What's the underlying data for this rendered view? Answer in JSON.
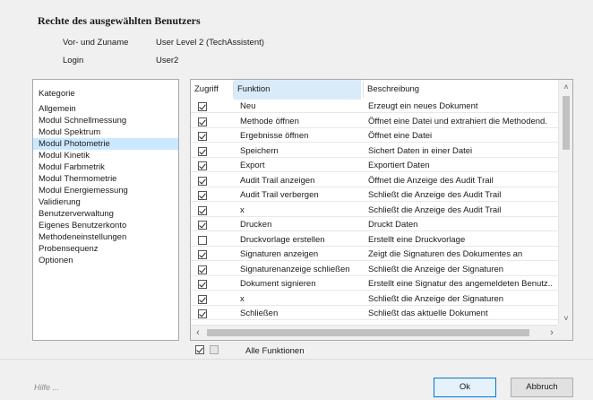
{
  "header": {
    "title": "Rechte des ausgewählten Benutzers",
    "name_label": "Vor- und Zuname",
    "name_value": "User Level 2 (TechAssistent)",
    "login_label": "Login",
    "login_value": "User2"
  },
  "categories": {
    "header": "Kategorie",
    "items": [
      "Allgemein",
      "Modul Schnellmessung",
      "Modul Spektrum",
      "Modul Photometrie",
      "Modul Kinetik",
      "Modul Farbmetrik",
      "Modul Thermometrie",
      "Modul Energiemessung",
      "Validierung",
      "Benutzerverwaltung",
      "Eigenes Benutzerkonto",
      "Methodeneinstellungen",
      "Probensequenz",
      "Optionen"
    ],
    "selected_index": 3
  },
  "table": {
    "columns": {
      "access": "Zugriff",
      "function": "Funktion",
      "description": "Beschreibung"
    },
    "rows": [
      {
        "checked": true,
        "function": "Neu",
        "description": "Erzeugt ein neues Dokument"
      },
      {
        "checked": true,
        "function": "Methode öffnen",
        "description": "Öffnet eine Datei und extrahiert die Methodend."
      },
      {
        "checked": true,
        "function": "Ergebnisse öffnen",
        "description": "Öffnet eine Datei"
      },
      {
        "checked": true,
        "function": "Speichern",
        "description": "Sichert Daten in einer Datei"
      },
      {
        "checked": true,
        "function": "Export",
        "description": "Exportiert Daten"
      },
      {
        "checked": true,
        "function": "Audit Trail anzeigen",
        "description": "Öffnet die Anzeige des Audit Trail"
      },
      {
        "checked": true,
        "function": "Audit Trail verbergen",
        "description": "Schließt die Anzeige des Audit Trail"
      },
      {
        "checked": true,
        "function": "x",
        "description": "Schließt die Anzeige des Audit Trail"
      },
      {
        "checked": true,
        "function": "Drucken",
        "description": "Druckt Daten"
      },
      {
        "checked": false,
        "function": "Druckvorlage erstellen",
        "description": "Erstellt eine Druckvorlage"
      },
      {
        "checked": true,
        "function": "Signaturen anzeigen",
        "description": "Zeigt die Signaturen des Dokumentes an"
      },
      {
        "checked": true,
        "function": "Signaturenanzeige schließen",
        "description": "Schließt die Anzeige der Signaturen"
      },
      {
        "checked": true,
        "function": "Dokument signieren",
        "description": "Erstellt eine Signatur des angemeldeten Benutz.."
      },
      {
        "checked": true,
        "function": "x",
        "description": "Schließt die Anzeige der Signaturen"
      },
      {
        "checked": true,
        "function": "Schließen",
        "description": "Schließt das aktuelle Dokument"
      }
    ]
  },
  "all_functions": {
    "label": "Alle Funktionen",
    "checked": true
  },
  "footer": {
    "help_text": "Hilfe ...",
    "ok_label": "Ok",
    "cancel_label": "Abbruch"
  },
  "icons": {
    "scroll_up": "chevron-up-icon",
    "scroll_down": "chevron-down-icon",
    "scroll_left": "chevron-left-icon",
    "scroll_right": "chevron-right-icon",
    "checkbox": "checkbox-icon"
  }
}
